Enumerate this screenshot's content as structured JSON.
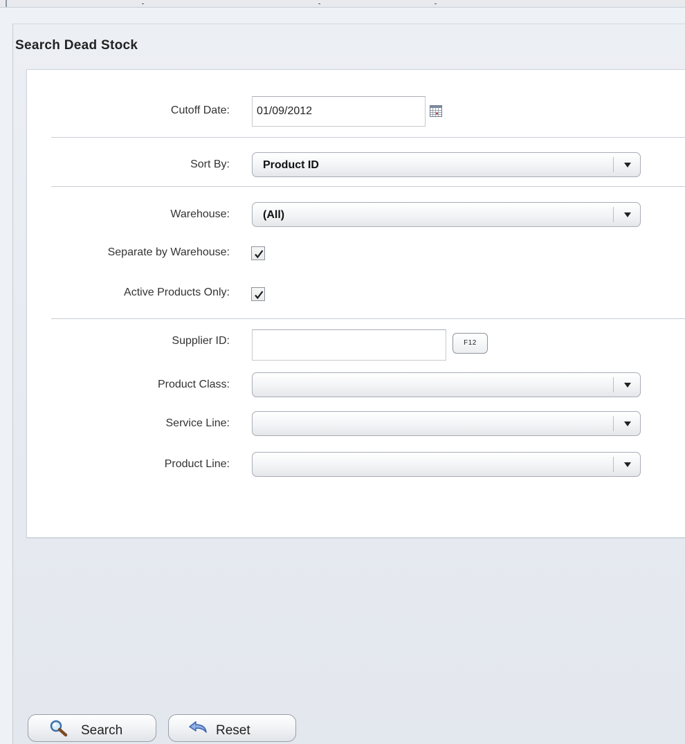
{
  "panel": {
    "title": "Search Dead Stock"
  },
  "form": {
    "cutoff_date": {
      "label": "Cutoff Date:",
      "value": "01/09/2012"
    },
    "sort_by": {
      "label": "Sort By:",
      "value": "Product ID"
    },
    "warehouse": {
      "label": "Warehouse:",
      "value": "(All)"
    },
    "separate_by_warehouse": {
      "label": "Separate by Warehouse:",
      "checked": true
    },
    "active_products_only": {
      "label": "Active Products Only:",
      "checked": true
    },
    "supplier_id": {
      "label": "Supplier ID:",
      "value": "",
      "lookup_label": "F12"
    },
    "product_class": {
      "label": "Product Class:",
      "value": ""
    },
    "service_line": {
      "label": "Service Line:",
      "value": ""
    },
    "product_line": {
      "label": "Product Line:",
      "value": ""
    }
  },
  "actions": {
    "search_label": "Search",
    "reset_label": "Reset"
  },
  "icons": {
    "calendar": "calendar-icon",
    "search": "magnifier-icon",
    "reset": "undo-arrow-icon",
    "dropdown": "chevron-down-icon",
    "check": "checkmark-icon"
  },
  "colors": {
    "background": "#eef1f6",
    "form_background": "#ffffff",
    "text": "#333333"
  }
}
